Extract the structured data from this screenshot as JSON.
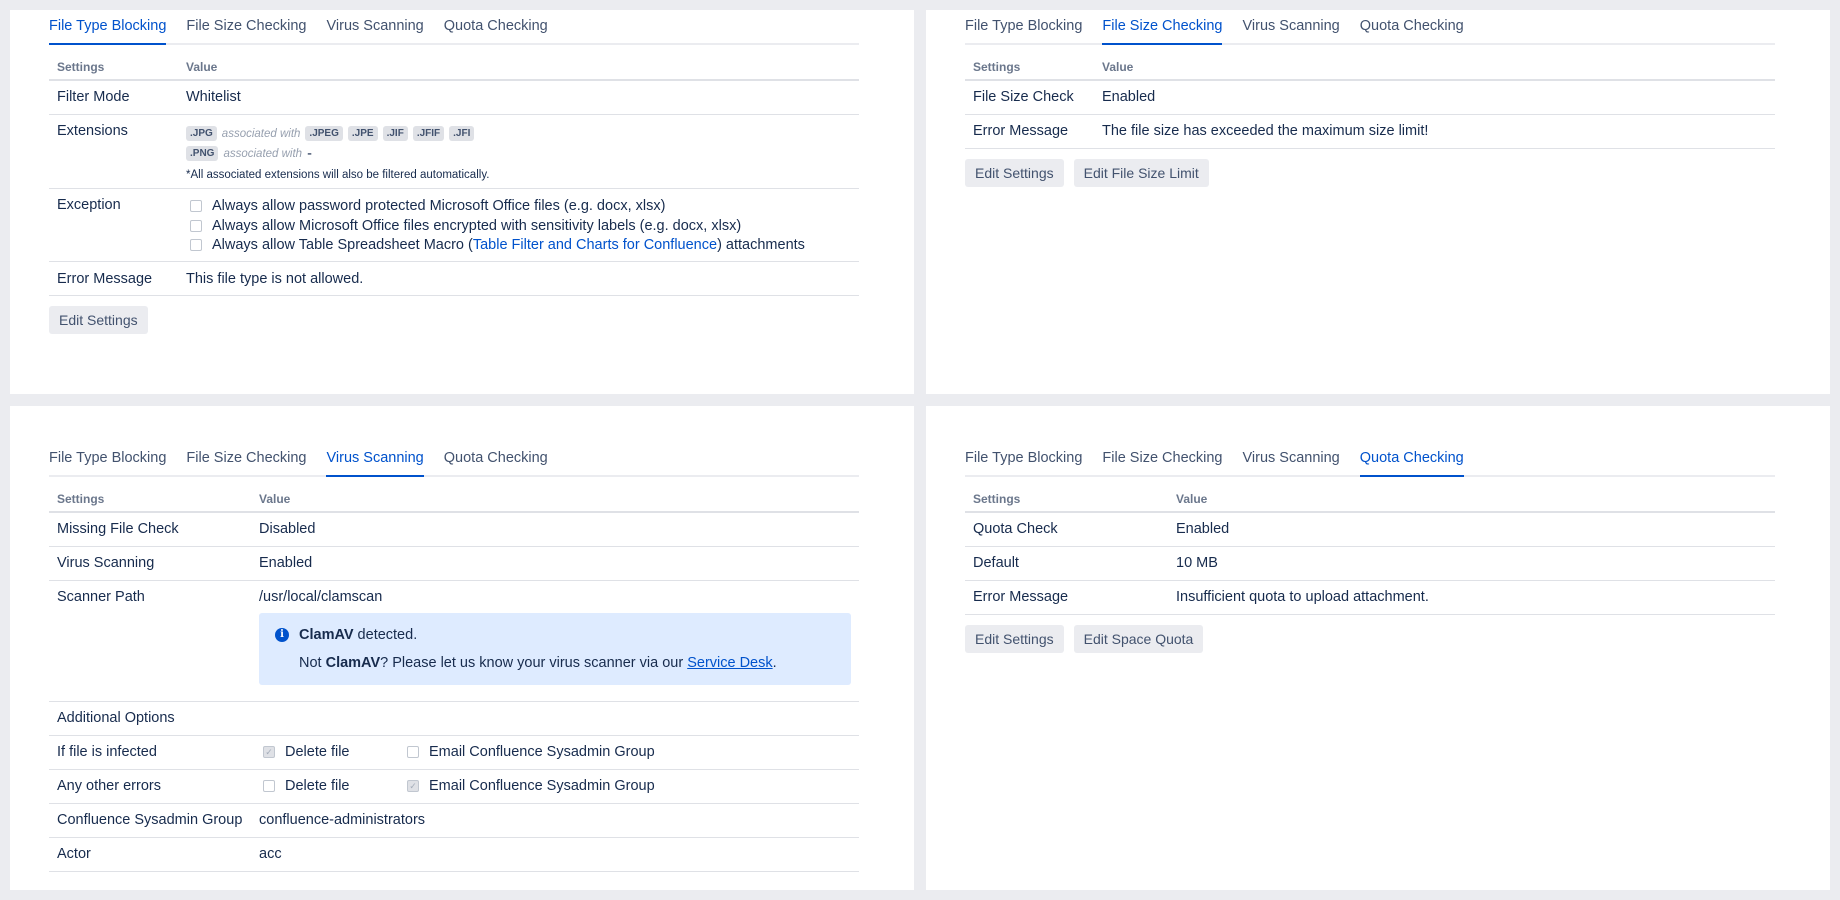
{
  "tabs": [
    "File Type Blocking",
    "File Size Checking",
    "Virus Scanning",
    "Quota Checking"
  ],
  "headers": {
    "settings": "Settings",
    "value": "Value"
  },
  "file_type": {
    "filter_mode_label": "Filter Mode",
    "filter_mode_value": "Whitelist",
    "extensions_label": "Extensions",
    "ext_groups": [
      {
        "main": ".JPG",
        "assoc_text": "associated with",
        "associated": [
          ".JPEG",
          ".JPE",
          ".JIF",
          ".JFIF",
          ".JFI"
        ]
      },
      {
        "main": ".PNG",
        "assoc_text": "associated with",
        "associated_none": "-"
      }
    ],
    "ext_note": "*All associated extensions will also be filtered automatically.",
    "exception_label": "Exception",
    "exception_1": "Always allow password protected Microsoft Office files (e.g. docx, xlsx)",
    "exception_2": "Always allow Microsoft Office files encrypted with sensitivity labels (e.g. docx, xlsx)",
    "exception_3_pre": "Always allow Table Spreadsheet Macro (",
    "exception_3_link": "Table Filter and Charts for Confluence",
    "exception_3_post": ") attachments",
    "error_label": "Error Message",
    "error_value": "This file type is not allowed.",
    "edit_btn": "Edit Settings"
  },
  "file_size": {
    "check_label": "File Size Check",
    "check_value": "Enabled",
    "error_label": "Error Message",
    "error_value": "The file size has exceeded the maximum size limit!",
    "edit_btn": "Edit Settings",
    "limit_btn": "Edit File Size Limit"
  },
  "virus": {
    "missing_label": "Missing File Check",
    "missing_value": "Disabled",
    "scanning_label": "Virus Scanning",
    "scanning_value": "Enabled",
    "path_label": "Scanner Path",
    "path_value": "/usr/local/clamscan",
    "info_bold": "ClamAV",
    "info_detected": " detected.",
    "info_not": "Not ",
    "info_bold2": "ClamAV",
    "info_rest": "? Please let us know your virus scanner via our ",
    "info_link": "Service Desk",
    "info_end": ".",
    "additional_label": "Additional Options",
    "infected_label": "If file is infected",
    "other_label": "Any other errors",
    "delete_file": "Delete file",
    "email_group": "Email Confluence Sysadmin Group",
    "sysadmin_label": "Confluence Sysadmin Group",
    "sysadmin_value": "confluence-administrators",
    "actor_label": "Actor",
    "actor_value": "acc"
  },
  "quota": {
    "check_label": "Quota Check",
    "check_value": "Enabled",
    "default_label": "Default",
    "default_value": "10 MB",
    "error_label": "Error Message",
    "error_value": "Insufficient quota to upload attachment.",
    "edit_btn": "Edit Settings",
    "space_btn": "Edit Space Quota"
  }
}
